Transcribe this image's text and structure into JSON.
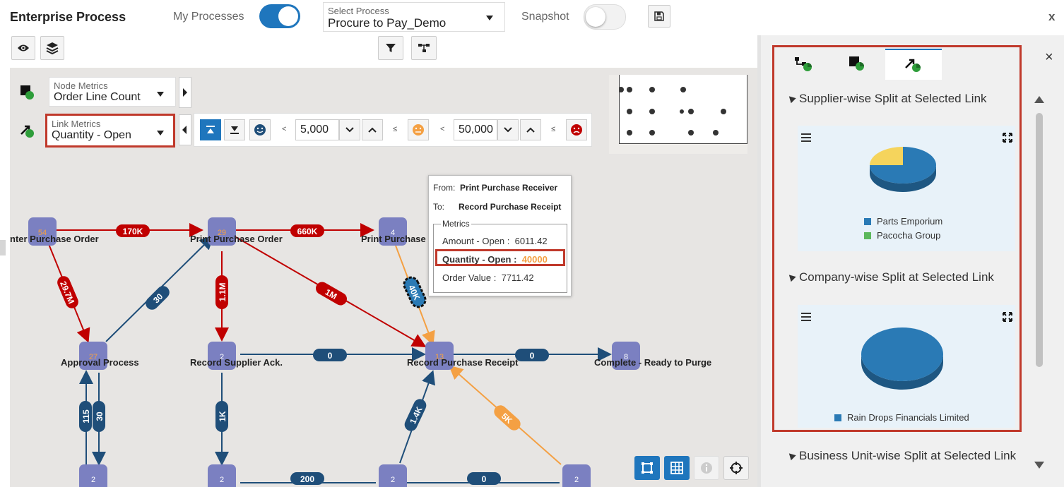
{
  "header": {
    "title": "Enterprise Process",
    "my_processes_label": "My Processes",
    "process_select": {
      "label": "Select Process",
      "value": "Procure to Pay_Demo"
    },
    "snapshot_label": "Snapshot",
    "close_symbol": "x"
  },
  "metrics": {
    "node": {
      "label": "Node Metrics",
      "value": "Order Line Count"
    },
    "link": {
      "label": "Link Metrics",
      "value": "Quantity - Open"
    }
  },
  "thresholds": {
    "lower_value": "5,000",
    "upper_value": "50,000",
    "lt": "<",
    "le": "≤"
  },
  "graph": {
    "nodes": [
      {
        "count": "54",
        "label": "nter Purchase Order"
      },
      {
        "count": "29",
        "label": "Print Purchase Order"
      },
      {
        "count": "4",
        "label": "Print Purchase"
      },
      {
        "count": "27",
        "label": "Approval Process"
      },
      {
        "count": "2",
        "label": "Record Supplier Ack."
      },
      {
        "count": "13",
        "label": "Record Purchase Receipt"
      },
      {
        "count": "8",
        "label": "Complete - Ready to Purge"
      },
      {
        "count": "2",
        "label": ""
      },
      {
        "count": "2",
        "label": ""
      },
      {
        "count": "2",
        "label": ""
      },
      {
        "count": "2",
        "label": ""
      }
    ],
    "edges": [
      "170K",
      "660K",
      "29.7M",
      "30",
      "1.1M",
      "1M",
      "40K",
      "0",
      "0",
      "115",
      "30",
      "1K",
      "1.4K",
      "5K",
      "200",
      "0"
    ]
  },
  "tooltip": {
    "from_label": "From:",
    "from_value": "Print Purchase Receiver",
    "to_label": "To:",
    "to_value": "Record Purchase Receipt",
    "metrics_legend": "Metrics",
    "amount_label": "Amount - Open :",
    "amount_value": "6011.42",
    "quantity_label": "Quantity - Open :",
    "quantity_value": "40000",
    "order_value_label": "Order Value :",
    "order_value_value": "7711.42"
  },
  "right_panel": {
    "close_symbol": "×",
    "sections": [
      {
        "title": "Supplier-wise Split at Selected Link",
        "legend": [
          "Parts Emporium",
          "Pacocha Group"
        ],
        "slices": [
          {
            "share": 0.75,
            "color": "#2a7ab5"
          },
          {
            "share": 0.25,
            "color": "#f5d45c"
          }
        ]
      },
      {
        "title": "Company-wise Split at Selected Link",
        "legend": [
          "Rain Drops Financials Limited"
        ],
        "slices": [
          {
            "share": 1.0,
            "color": "#2a7ab5"
          }
        ]
      },
      {
        "title": "Business Unit-wise Split at Selected Link"
      }
    ]
  },
  "colors": {
    "primary_blue": "#1f76bd",
    "red_edge": "#c00000",
    "blue_edge": "#1f4e79",
    "orange_edge": "#f4a043",
    "node_fill": "#7b80c1",
    "highlight_red": "#c0392b",
    "legend_green": "#5cb85c"
  },
  "icons": [
    "eye-icon",
    "layers-icon",
    "filter-icon",
    "tree-icon",
    "save-icon",
    "fit-icon",
    "grid-icon",
    "info-icon",
    "crosshair-icon"
  ]
}
